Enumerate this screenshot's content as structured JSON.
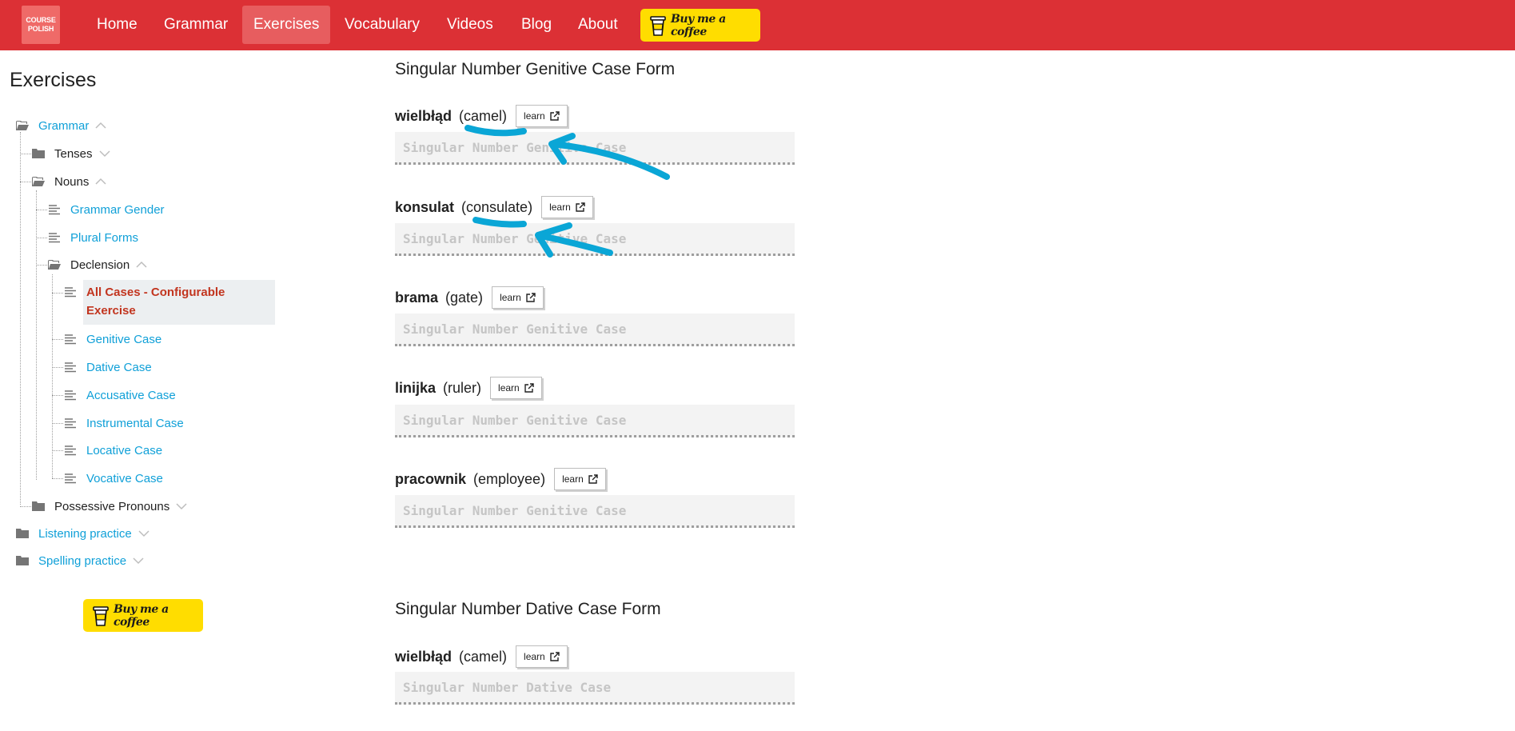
{
  "logo": {
    "line1": "COURSE",
    "line2": "POLISH"
  },
  "nav": {
    "items": [
      {
        "label": "Home"
      },
      {
        "label": "Grammar"
      },
      {
        "label": "Exercises",
        "active": true
      },
      {
        "label": "Vocabulary"
      },
      {
        "label": "Videos"
      },
      {
        "label": "Blog"
      },
      {
        "label": "About"
      }
    ],
    "coffee_label": "Buy me a coffee"
  },
  "sidebar": {
    "title": "Exercises",
    "tree": {
      "grammar": "Grammar",
      "tenses": "Tenses",
      "nouns": "Nouns",
      "grammar_gender": "Grammar Gender",
      "plural_forms": "Plural Forms",
      "declension": "Declension",
      "all_cases": "All Cases - Configurable Exercise",
      "genitive": "Genitive Case",
      "dative": "Dative Case",
      "accusative": "Accusative Case",
      "instrumental": "Instrumental Case",
      "locative": "Locative Case",
      "vocative": "Vocative Case",
      "possessive_pronouns": "Possessive Pronouns",
      "listening": "Listening practice",
      "spelling": "Spelling practice"
    },
    "coffee_label": "Buy me a coffee"
  },
  "main": {
    "learn_label": "learn",
    "sections": [
      {
        "title": "Singular Number Genitive Case Form",
        "placeholder": "Singular Number Genitive Case",
        "items": [
          {
            "word": "wielbłąd",
            "translation": "(camel)"
          },
          {
            "word": "konsulat",
            "translation": "(consulate)"
          },
          {
            "word": "brama",
            "translation": "(gate)"
          },
          {
            "word": "linijka",
            "translation": "(ruler)"
          },
          {
            "word": "pracownik",
            "translation": "(employee)"
          }
        ]
      },
      {
        "title": "Singular Number Dative Case Form",
        "placeholder": "Singular Number Dative Case",
        "items": [
          {
            "word": "wielbłąd",
            "translation": "(camel)"
          }
        ]
      }
    ]
  },
  "colors": {
    "brand_red": "#dc3035",
    "link_blue": "#10a0d8",
    "active_item": "#c2351f",
    "coffee_yellow": "#ffdd00",
    "annotation_blue": "#0aa6d6"
  }
}
